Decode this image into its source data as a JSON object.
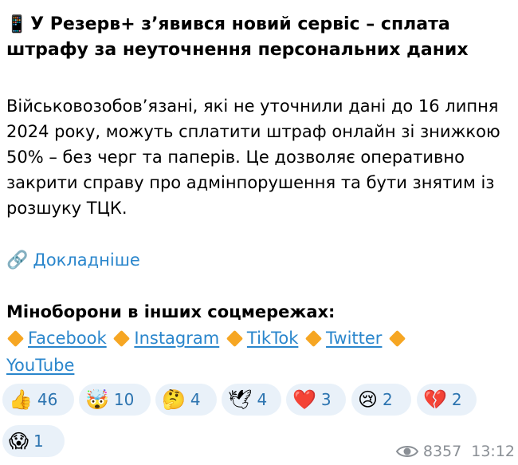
{
  "post": {
    "title_emoji": "📱",
    "title": "У Резерв+ з’явився новий сервіс – сплата штрафу за неуточнення персональних даних",
    "body": "Військовозобов’язані, які не уточнили дані до 16 липня 2024 року, можуть сплатити штраф онлайн зі знижкою 50% – без черг та паперів. Це дозволяє оперативно закрити справу про адмінпорушення та бути знятим із розшуку ТЦК.",
    "more_emoji": "🔗",
    "more_label": "Докладніше",
    "social_heading": "Міноборони в інших соцмережах:",
    "social_links": [
      "Facebook",
      "Instagram",
      "TikTok",
      "Twitter",
      "YouTube"
    ]
  },
  "reactions": [
    {
      "emoji": "👍",
      "count": "46"
    },
    {
      "emoji": "🤯",
      "count": "10"
    },
    {
      "emoji": "🤔",
      "count": "4"
    },
    {
      "emoji": "🕊",
      "count": "4"
    },
    {
      "emoji": "❤️",
      "count": "3"
    },
    {
      "emoji": "😢",
      "count": "2"
    },
    {
      "emoji": "💔",
      "count": "2"
    },
    {
      "emoji": "😱",
      "count": "1"
    }
  ],
  "meta": {
    "views": "8357",
    "time": "13:12"
  },
  "colors": {
    "link": "#2a86cc",
    "reaction_bg": "#e9f1f9",
    "reaction_count": "#2c74b0",
    "meta": "#8a8f95",
    "bullet": "#f6a623"
  }
}
